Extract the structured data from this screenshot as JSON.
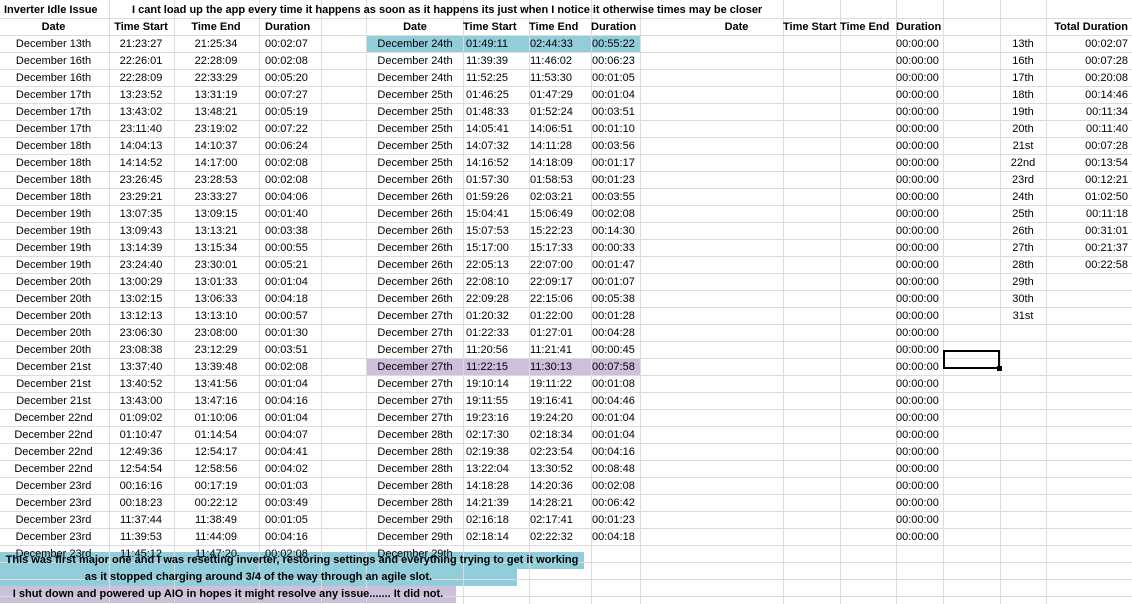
{
  "header": {
    "title": "Inverter Idle Issue",
    "note": "I cant load up the app every time it happens as soon as it happens its just when I notice it otherwise times may be closer",
    "date": "Date",
    "time_start": "Time Start",
    "time_end": "Time End",
    "duration": "Duration",
    "total_duration": "Total Duration"
  },
  "colors": {
    "blue": "#92cddc",
    "purple": "#ccc0da",
    "grid": "#dcdcdc"
  },
  "table1": [
    [
      "December 13th",
      "21:23:27",
      "21:25:34",
      "00:02:07"
    ],
    [
      "December 16th",
      "22:26:01",
      "22:28:09",
      "00:02:08"
    ],
    [
      "December 16th",
      "22:28:09",
      "22:33:29",
      "00:05:20"
    ],
    [
      "December 17th",
      "13:23:52",
      "13:31:19",
      "00:07:27"
    ],
    [
      "December 17th",
      "13:43:02",
      "13:48:21",
      "00:05:19"
    ],
    [
      "December 17th",
      "23:11:40",
      "23:19:02",
      "00:07:22"
    ],
    [
      "December 18th",
      "14:04:13",
      "14:10:37",
      "00:06:24"
    ],
    [
      "December 18th",
      "14:14:52",
      "14:17:00",
      "00:02:08"
    ],
    [
      "December 18th",
      "23:26:45",
      "23:28:53",
      "00:02:08"
    ],
    [
      "December 18th",
      "23:29:21",
      "23:33:27",
      "00:04:06"
    ],
    [
      "December 19th",
      "13:07:35",
      "13:09:15",
      "00:01:40"
    ],
    [
      "December 19th",
      "13:09:43",
      "13:13:21",
      "00:03:38"
    ],
    [
      "December 19th",
      "13:14:39",
      "13:15:34",
      "00:00:55"
    ],
    [
      "December 19th",
      "23:24:40",
      "23:30:01",
      "00:05:21"
    ],
    [
      "December 20th",
      "13:00:29",
      "13:01:33",
      "00:01:04"
    ],
    [
      "December 20th",
      "13:02:15",
      "13:06:33",
      "00:04:18"
    ],
    [
      "December 20th",
      "13:12:13",
      "13:13:10",
      "00:00:57"
    ],
    [
      "December 20th",
      "23:06:30",
      "23:08:00",
      "00:01:30"
    ],
    [
      "December 20th",
      "23:08:38",
      "23:12:29",
      "00:03:51"
    ],
    [
      "December 21st",
      "13:37:40",
      "13:39:48",
      "00:02:08"
    ],
    [
      "December 21st",
      "13:40:52",
      "13:41:56",
      "00:01:04"
    ],
    [
      "December 21st",
      "13:43:00",
      "13:47:16",
      "00:04:16"
    ],
    [
      "December 22nd",
      "01:09:02",
      "01:10:06",
      "00:01:04"
    ],
    [
      "December 22nd",
      "01:10:47",
      "01:14:54",
      "00:04:07"
    ],
    [
      "December 22nd",
      "12:49:36",
      "12:54:17",
      "00:04:41"
    ],
    [
      "December 22nd",
      "12:54:54",
      "12:58:56",
      "00:04:02"
    ],
    [
      "December 23rd",
      "00:16:16",
      "00:17:19",
      "00:01:03"
    ],
    [
      "December 23rd",
      "00:18:23",
      "00:22:12",
      "00:03:49"
    ],
    [
      "December 23rd",
      "11:37:44",
      "11:38:49",
      "00:01:05"
    ],
    [
      "December 23rd",
      "11:39:53",
      "11:44:09",
      "00:04:16"
    ],
    [
      "December 23rd",
      "11:45:12",
      "11:47:20",
      "00:02:08"
    ]
  ],
  "table2": [
    [
      "December 24th",
      "01:49:11",
      "02:44:33",
      "00:55:22"
    ],
    [
      "December 24th",
      "11:39:39",
      "11:46:02",
      "00:06:23"
    ],
    [
      "December 24th",
      "11:52:25",
      "11:53:30",
      "00:01:05"
    ],
    [
      "December 25th",
      "01:46:25",
      "01:47:29",
      "00:01:04"
    ],
    [
      "December 25th",
      "01:48:33",
      "01:52:24",
      "00:03:51"
    ],
    [
      "December 25th",
      "14:05:41",
      "14:06:51",
      "00:01:10"
    ],
    [
      "December 25th",
      "14:07:32",
      "14:11:28",
      "00:03:56"
    ],
    [
      "December 25th",
      "14:16:52",
      "14:18:09",
      "00:01:17"
    ],
    [
      "December 26th",
      "01:57:30",
      "01:58:53",
      "00:01:23"
    ],
    [
      "December 26th",
      "01:59:26",
      "02:03:21",
      "00:03:55"
    ],
    [
      "December 26th",
      "15:04:41",
      "15:06:49",
      "00:02:08"
    ],
    [
      "December 26th",
      "15:07:53",
      "15:22:23",
      "00:14:30"
    ],
    [
      "December 26th",
      "15:17:00",
      "15:17:33",
      "00:00:33"
    ],
    [
      "December 26th",
      "22:05:13",
      "22:07:00",
      "00:01:47"
    ],
    [
      "December 26th",
      "22:08:10",
      "22:09:17",
      "00:01:07"
    ],
    [
      "December 26th",
      "22:09:28",
      "22:15:06",
      "00:05:38"
    ],
    [
      "December 27th",
      "01:20:32",
      "01:22:00",
      "00:01:28"
    ],
    [
      "December 27th",
      "01:22:33",
      "01:27:01",
      "00:04:28"
    ],
    [
      "December 27th",
      "11:20:56",
      "11:21:41",
      "00:00:45"
    ],
    [
      "December 27th",
      "11:22:15",
      "11:30:13",
      "00:07:58"
    ],
    [
      "December 27th",
      "19:10:14",
      "19:11:22",
      "00:01:08"
    ],
    [
      "December 27th",
      "19:11:55",
      "19:16:41",
      "00:04:46"
    ],
    [
      "December 27th",
      "19:23:16",
      "19:24:20",
      "00:01:04"
    ],
    [
      "December 28th",
      "02:17:30",
      "02:18:34",
      "00:01:04"
    ],
    [
      "December 28th",
      "02:19:38",
      "02:23:54",
      "00:04:16"
    ],
    [
      "December 28th",
      "13:22:04",
      "13:30:52",
      "00:08:48"
    ],
    [
      "December 28th",
      "14:18:28",
      "14:20:36",
      "00:02:08"
    ],
    [
      "December 28th",
      "14:21:39",
      "14:28:21",
      "00:06:42"
    ],
    [
      "December 29th",
      "02:16:18",
      "02:17:41",
      "00:01:23"
    ],
    [
      "December 29th",
      "02:18:14",
      "02:22:32",
      "00:04:18"
    ],
    [
      "December 29th",
      "",
      "",
      ""
    ]
  ],
  "table3_durations": [
    "00:00:00",
    "00:00:00",
    "00:00:00",
    "00:00:00",
    "00:00:00",
    "00:00:00",
    "00:00:00",
    "00:00:00",
    "00:00:00",
    "00:00:00",
    "00:00:00",
    "00:00:00",
    "00:00:00",
    "00:00:00",
    "00:00:00",
    "00:00:00",
    "00:00:00",
    "00:00:00",
    "00:00:00",
    "00:00:00",
    "00:00:00",
    "00:00:00",
    "00:00:00",
    "00:00:00",
    "00:00:00",
    "00:00:00",
    "00:00:00",
    "00:00:00",
    "00:00:00",
    "00:00:00"
  ],
  "totals": [
    [
      "13th",
      "00:02:07"
    ],
    [
      "16th",
      "00:07:28"
    ],
    [
      "17th",
      "00:20:08"
    ],
    [
      "18th",
      "00:14:46"
    ],
    [
      "19th",
      "00:11:34"
    ],
    [
      "20th",
      "00:11:40"
    ],
    [
      "21st",
      "00:07:28"
    ],
    [
      "22nd",
      "00:13:54"
    ],
    [
      "23rd",
      "00:12:21"
    ],
    [
      "24th",
      "01:02:50"
    ],
    [
      "25th",
      "00:11:18"
    ],
    [
      "26th",
      "00:31:01"
    ],
    [
      "27th",
      "00:21:37"
    ],
    [
      "28th",
      "00:22:58"
    ],
    [
      "29th",
      ""
    ],
    [
      "30th",
      ""
    ],
    [
      "31st",
      ""
    ]
  ],
  "notes": {
    "note1_line1": "This was first major one and I was resetting inverter, restoring settings and everything trying to get it working",
    "note1_line2": "as it stopped charging around 3/4 of the way through an agile slot.",
    "note2": "I shut down and powered up AIO in hopes it might resolve any issue....... It did not."
  }
}
